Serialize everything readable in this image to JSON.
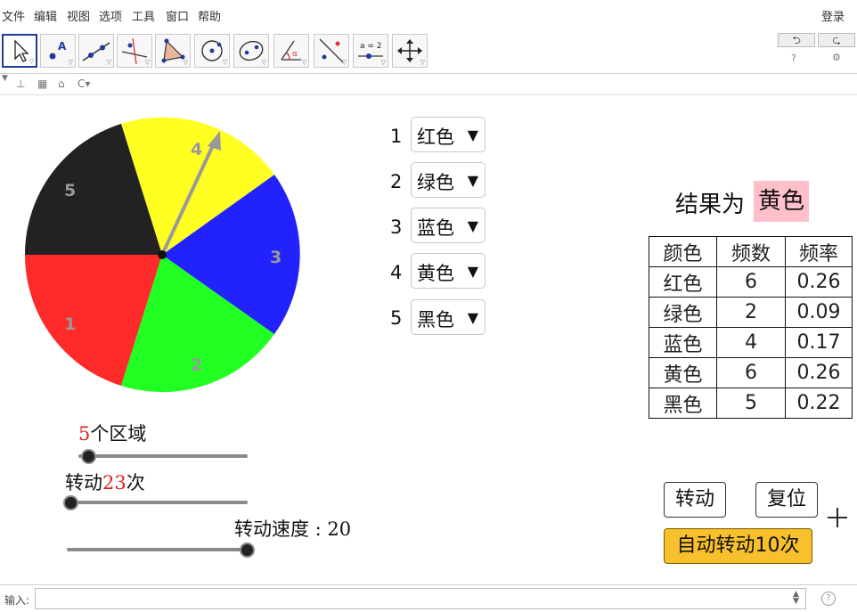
{
  "menu": {
    "items": [
      "文件",
      "编辑",
      "视图",
      "选项",
      "工具",
      "窗口",
      "帮助"
    ],
    "login": "登录"
  },
  "toolbar": {
    "tools": [
      "move-tool",
      "point-tool",
      "line-tool",
      "perpendicular-tool",
      "polygon-tool",
      "circle-tool",
      "conic-tool",
      "angle-tool",
      "reflect-tool",
      "slider-tool",
      "move-view-tool"
    ],
    "slider_tool_text": "a = 2",
    "undo_icon": "undo-icon",
    "redo_icon": "redo-icon"
  },
  "wheel": {
    "sectors": [
      {
        "label": "1",
        "color": "#ff2a2a"
      },
      {
        "label": "2",
        "color": "#22ff22"
      },
      {
        "label": "3",
        "color": "#2222ff"
      },
      {
        "label": "4",
        "color": "#ffff22"
      },
      {
        "label": "5",
        "color": "#222222"
      }
    ]
  },
  "assignments": [
    {
      "num": "1",
      "value": "红色"
    },
    {
      "num": "2",
      "value": "绿色"
    },
    {
      "num": "3",
      "value": "蓝色"
    },
    {
      "num": "4",
      "value": "黄色"
    },
    {
      "num": "5",
      "value": "黑色"
    }
  ],
  "result": {
    "label": "结果为",
    "value": "黄色",
    "highlight_color": "#ffc0cb"
  },
  "table": {
    "headers": [
      "颜色",
      "频数",
      "频率"
    ],
    "rows": [
      [
        "红色",
        "6",
        "0.26"
      ],
      [
        "绿色",
        "2",
        "0.09"
      ],
      [
        "蓝色",
        "4",
        "0.17"
      ],
      [
        "黄色",
        "6",
        "0.26"
      ],
      [
        "黑色",
        "5",
        "0.22"
      ]
    ]
  },
  "sliders": {
    "regions": {
      "value": "5",
      "suffix": "个区域"
    },
    "spins": {
      "prefix": "转动",
      "value": "23",
      "suffix": "次"
    },
    "speed": {
      "label": "转动速度 : 20"
    }
  },
  "buttons": {
    "spin": "转动",
    "reset": "复位",
    "auto": "自动转动10次",
    "auto_color": "#f7c02c"
  },
  "input_bar": {
    "label": "输入:",
    "value": ""
  }
}
